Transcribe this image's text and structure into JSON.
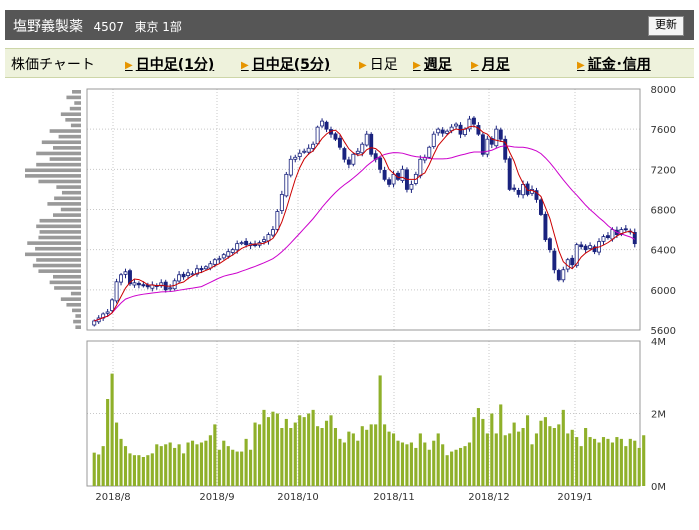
{
  "header": {
    "company": "塩野義製薬",
    "code": "4507",
    "market": "東京 1部",
    "refresh_label": "更新"
  },
  "nav": {
    "items": [
      {
        "label": "株価チャート",
        "link": false
      },
      {
        "label": "日中足(1分)",
        "link": true
      },
      {
        "label": "日中足(5分)",
        "link": true
      },
      {
        "label": "日足",
        "link": false
      },
      {
        "label": "週足",
        "link": true
      },
      {
        "label": "月足",
        "link": true
      },
      {
        "label": "証金･信用",
        "link": true
      }
    ]
  },
  "colors": {
    "candle_up": "#ffffff",
    "candle_down": "#1a237e",
    "candle_outline": "#1a237e",
    "ma_short": "#cc0000",
    "ma_long": "#cc00cc",
    "volume": "#8fb02a",
    "volume_profile": "#999999",
    "grid": "#c8c8c8"
  },
  "chart_data": [
    {
      "type": "candlestick",
      "title": "",
      "y_ticks": [
        "8000",
        "7600",
        "7200",
        "6800",
        "6400",
        "6000",
        "5600"
      ],
      "ylim": [
        5600,
        8000
      ],
      "x_ticks": [
        "2018/8",
        "2018/9",
        "2018/10",
        "2018/11",
        "2018/12",
        "2019/1"
      ],
      "grid": true,
      "series": [
        {
          "type": "candlestick",
          "closes": [
            5690,
            5720,
            5760,
            5780,
            5900,
            6080,
            6150,
            6180,
            6060,
            6070,
            6050,
            6040,
            6030,
            6050,
            6040,
            6070,
            6000,
            6020,
            6090,
            6150,
            6130,
            6170,
            6160,
            6210,
            6200,
            6230,
            6260,
            6300,
            6310,
            6350,
            6380,
            6400,
            6460,
            6470,
            6450,
            6460,
            6440,
            6470,
            6500,
            6550,
            6600,
            6780,
            6950,
            7150,
            7300,
            7320,
            7360,
            7380,
            7410,
            7450,
            7620,
            7680,
            7600,
            7550,
            7500,
            7420,
            7300,
            7250,
            7350,
            7380,
            7450,
            7550,
            7350,
            7300,
            7200,
            7100,
            7050,
            7150,
            7100,
            7200,
            7000,
            7050,
            7150,
            7300,
            7320,
            7420,
            7550,
            7600,
            7560,
            7580,
            7620,
            7650,
            7550,
            7600,
            7700,
            7650,
            7550,
            7350,
            7500,
            7450,
            7600,
            7500,
            7300,
            7000,
            7000,
            6950,
            7050,
            6950,
            7000,
            6900,
            6750,
            6500,
            6400,
            6200,
            6100,
            6200,
            6300,
            6250,
            6450,
            6430,
            6400,
            6440,
            6380,
            6480,
            6530,
            6520,
            6600,
            6550,
            6600,
            6600,
            6580,
            6460
          ]
        },
        {
          "type": "line",
          "name": "",
          "note": "short moving average"
        },
        {
          "type": "line",
          "name": "",
          "note": "long moving average"
        }
      ]
    },
    {
      "type": "bar",
      "title": "",
      "y_ticks": [
        "4M",
        "2M",
        "0M"
      ],
      "ylim": [
        0,
        4000000
      ],
      "values": [
        920000,
        870000,
        1100000,
        2400000,
        3100000,
        1750000,
        1300000,
        1100000,
        900000,
        850000,
        850000,
        800000,
        850000,
        900000,
        1150000,
        1100000,
        1150000,
        1200000,
        1050000,
        1150000,
        900000,
        1200000,
        1250000,
        1150000,
        1200000,
        1250000,
        1400000,
        1700000,
        1000000,
        1250000,
        1100000,
        1000000,
        950000,
        950000,
        1300000,
        1000000,
        1750000,
        1700000,
        2100000,
        1900000,
        2050000,
        2000000,
        1600000,
        1850000,
        1600000,
        1750000,
        1950000,
        1900000,
        2000000,
        2100000,
        1650000,
        1600000,
        1800000,
        1950000,
        1600000,
        1300000,
        1200000,
        1500000,
        1450000,
        1250000,
        1650000,
        1550000,
        1700000,
        1700000,
        3050000,
        1700000,
        1500000,
        1450000,
        1250000,
        1200000,
        1150000,
        1200000,
        1050000,
        1450000,
        1200000,
        1000000,
        1250000,
        1450000,
        1150000,
        850000,
        950000,
        1000000,
        1050000,
        1100000,
        1200000,
        1900000,
        2150000,
        1850000,
        1450000,
        2000000,
        1450000,
        2250000,
        1400000,
        1450000,
        1750000,
        1500000,
        1600000,
        1950000,
        1150000,
        1450000,
        1800000,
        1900000,
        1650000,
        1600000,
        1700000,
        2100000,
        1450000,
        1550000,
        1350000,
        1100000,
        1600000,
        1350000,
        1300000,
        1200000,
        1350000,
        1300000,
        1200000,
        1350000,
        1300000,
        1100000,
        1300000,
        1250000,
        1050000,
        1400000
      ]
    },
    {
      "type": "bar",
      "title": "",
      "orientation": "horizontal",
      "values": [
        0.05,
        0.07,
        0.05,
        0.08,
        0.13,
        0.18,
        0.09,
        0.24,
        0.28,
        0.25,
        0.38,
        0.43,
        0.4,
        0.5,
        0.41,
        0.48,
        0.38,
        0.37,
        0.4,
        0.37,
        0.25,
        0.18,
        0.3,
        0.24,
        0.17,
        0.22,
        0.38,
        0.5,
        0.5,
        0.4,
        0.28,
        0.4,
        0.25,
        0.35,
        0.2,
        0.28,
        0.09,
        0.14,
        0.18,
        0.1,
        0.06,
        0.13,
        0.08
      ]
    }
  ]
}
